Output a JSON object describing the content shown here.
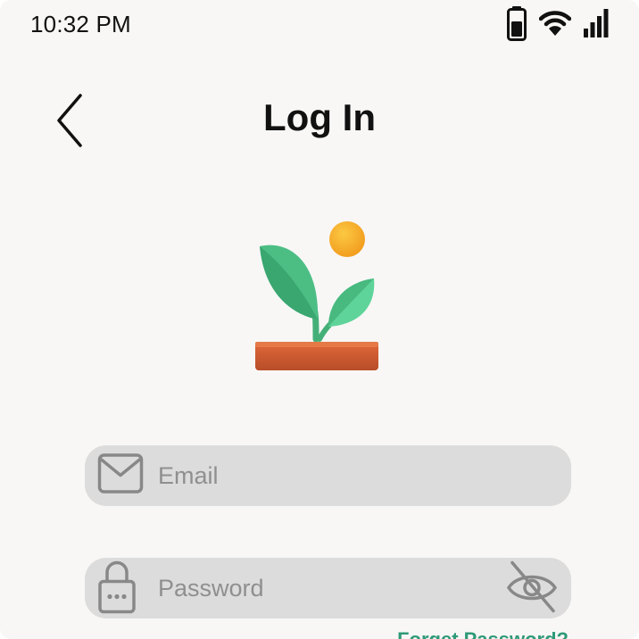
{
  "status_bar": {
    "time": "10:32 PM",
    "icons": [
      "battery-icon",
      "wifi-icon",
      "signal-icon"
    ]
  },
  "header": {
    "title": "Log In",
    "back_icon": "chevron-left-icon"
  },
  "logo": {
    "icon": "plant-sprout-icon",
    "colors": {
      "leaf": "#4cbe84",
      "leaf_light": "#5fd49a",
      "sun": "#f6a91f",
      "pot": "#d15a2f"
    }
  },
  "form": {
    "email": {
      "placeholder": "Email",
      "value": "",
      "icon": "envelope-icon"
    },
    "password": {
      "placeholder": "Password",
      "value": "",
      "icon": "lock-icon",
      "toggle_icon": "eye-off-icon"
    },
    "forgot_password": "Forget Password?"
  },
  "colors": {
    "background": "#f8f7f6",
    "field_background": "#dcdcdc",
    "accent": "#2f9a78"
  }
}
